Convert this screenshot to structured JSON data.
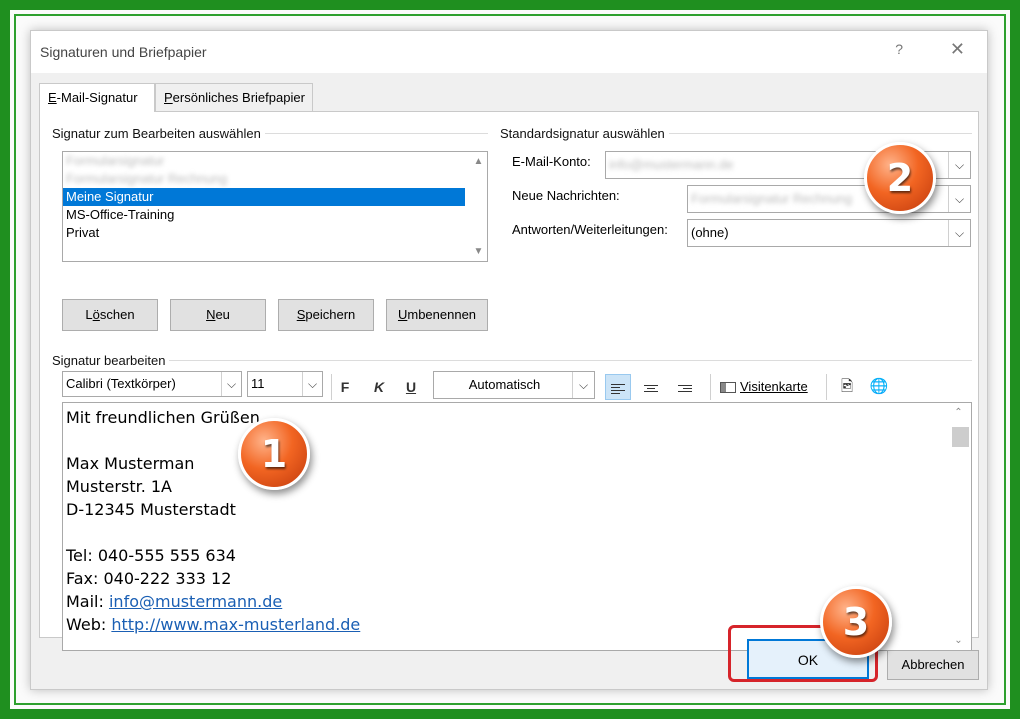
{
  "dialog": {
    "title": "Signaturen und Briefpapier",
    "help": "?",
    "close": "✕"
  },
  "tabs": [
    {
      "label_prefix": "",
      "accel": "E",
      "label_rest": "-Mail-Signatur"
    },
    {
      "label_prefix": "",
      "accel": "P",
      "label_rest": "ersönliches Briefpapier"
    }
  ],
  "select_group": {
    "label": "Signatur zum Bearbeiten auswählen",
    "items": [
      {
        "label": "Formularsignatur",
        "blurred": true
      },
      {
        "label": "Formularsignatur Rechnung",
        "blurred": true
      },
      {
        "label": "Meine Signatur",
        "selected": true
      },
      {
        "label": "MS-Office-Training"
      },
      {
        "label": "Privat"
      }
    ],
    "buttons": {
      "delete": {
        "pre": "L",
        "accel": "ö",
        "post": "schen"
      },
      "new": {
        "pre": "",
        "accel": "N",
        "post": "eu"
      },
      "save": {
        "pre": "",
        "accel": "S",
        "post": "peichern"
      },
      "rename": {
        "pre": "",
        "accel": "U",
        "post": "mbenennen"
      }
    }
  },
  "default_group": {
    "label": "Standardsignatur auswählen",
    "account_label": "E-Mail-Konto:",
    "account_value": "info@mustermann.de",
    "new_msg_label": "Neue Nachrichten:",
    "new_msg_value": "Formularsignatur Rechnung",
    "reply_label": "Antworten/Weiterleitungen:",
    "reply_value": "(ohne)"
  },
  "edit_group": {
    "label": "Signatur bearbeiten",
    "font": "Calibri (Textkörper)",
    "size": "11",
    "bold": "F",
    "italic": "K",
    "underline": "U",
    "color": "Automatisch",
    "vcard": "Visitenkarte"
  },
  "signature": {
    "greeting": "Mit freundlichen Grüßen",
    "name": "Max Musterman",
    "street": "Musterstr. 1A",
    "city": "D-12345 Musterstadt",
    "tel": "Tel: 040-555 555 634",
    "fax": "Fax: 040-222 333 12",
    "mail_label": "Mail: ",
    "mail_link": "info@mustermann.de",
    "web_label": "Web: ",
    "web_link": "http://www.max-musterland.de"
  },
  "footer": {
    "ok": "OK",
    "cancel": "Abbrechen"
  },
  "badges": [
    "1",
    "2",
    "3"
  ],
  "colors": {
    "frame_green": "#1f8f1f",
    "selection_blue": "#0078d7",
    "badge_orange": "#f26522",
    "highlight_red": "#d6242a",
    "link_blue": "#1a5fb4"
  }
}
